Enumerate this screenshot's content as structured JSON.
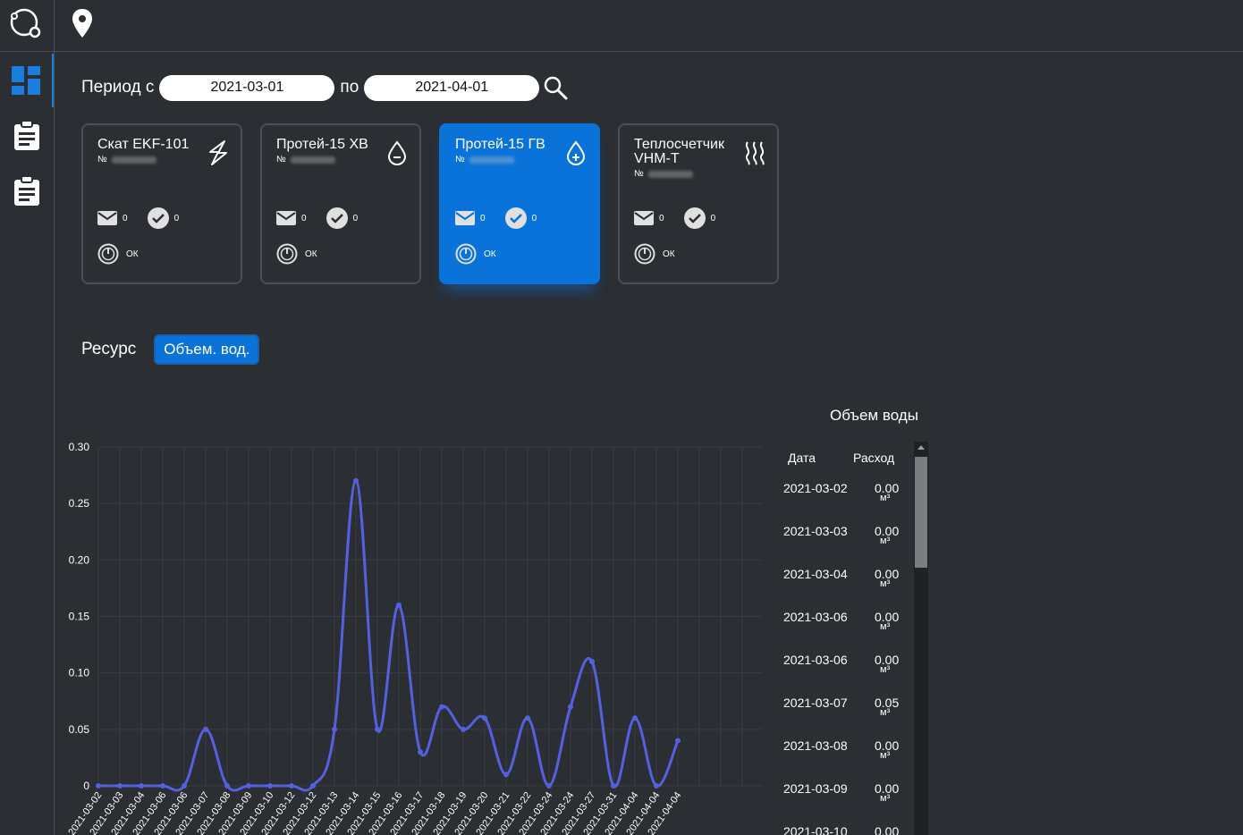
{
  "period": {
    "from_label": "Период с",
    "from_value": "2021-03-01",
    "to_label": "по",
    "to_value": "2021-04-01"
  },
  "cards": [
    {
      "title": "Скат EKF-101",
      "serial_prefix": "№",
      "messages": "0",
      "checks": "0",
      "status": "ОК",
      "icon": "lightning-icon",
      "active": false
    },
    {
      "title": "Протей-15 ХВ",
      "serial_prefix": "№",
      "messages": "0",
      "checks": "0",
      "status": "ОК",
      "icon": "water-drop-icon",
      "active": false
    },
    {
      "title": "Протей-15 ГВ",
      "serial_prefix": "№",
      "messages": "0",
      "checks": "0",
      "status": "ОК",
      "icon": "hot-water-drop-icon",
      "active": true
    },
    {
      "title": "Теплосчетчик VHM-T",
      "serial_prefix": "№",
      "messages": "0",
      "checks": "0",
      "status": "ОК",
      "icon": "heat-icon",
      "active": false
    }
  ],
  "resource": {
    "label": "Ресурс",
    "button": "Объем. вод."
  },
  "table": {
    "title": "Объем воды",
    "col_date": "Дата",
    "col_value": "Расход",
    "unit": "м³",
    "rows": [
      {
        "date": "2021-03-02",
        "value": "0.00"
      },
      {
        "date": "2021-03-03",
        "value": "0.00"
      },
      {
        "date": "2021-03-04",
        "value": "0.00"
      },
      {
        "date": "2021-03-06",
        "value": "0.00"
      },
      {
        "date": "2021-03-06",
        "value": "0.00"
      },
      {
        "date": "2021-03-07",
        "value": "0.05"
      },
      {
        "date": "2021-03-08",
        "value": "0.00"
      },
      {
        "date": "2021-03-09",
        "value": "0.00"
      },
      {
        "date": "2021-03-10",
        "value": "0.00"
      }
    ]
  },
  "colors": {
    "accent": "#0a73d9",
    "line": "#5560e0",
    "background": "#2b2e33"
  },
  "chart_data": {
    "type": "line",
    "categories": [
      "2021-03-02",
      "2021-03-03",
      "2021-03-04",
      "2021-03-06",
      "2021-03-06",
      "2021-03-07",
      "2021-03-08",
      "2021-03-09",
      "2021-03-10",
      "2021-03-12",
      "2021-03-12",
      "2021-03-13",
      "2021-03-14",
      "2021-03-15",
      "2021-03-16",
      "2021-03-17",
      "2021-03-18",
      "2021-03-19",
      "2021-03-20",
      "2021-03-21",
      "2021-03-22",
      "2021-03-24",
      "2021-03-24",
      "2021-03-27",
      "2021-03-31",
      "2021-04-04",
      "2021-04-04",
      "2021-04-04"
    ],
    "values": [
      0,
      0,
      0,
      0,
      0,
      0.05,
      0,
      0,
      0,
      0,
      0,
      0.05,
      0.27,
      0.05,
      0.16,
      0.03,
      0.07,
      0.05,
      0.06,
      0.01,
      0.06,
      0,
      0.07,
      0.11,
      0,
      0.06,
      0,
      0.04
    ],
    "ylim": [
      0,
      0.3
    ],
    "yticks": [
      "0",
      "0.05",
      "0.10",
      "0.15",
      "0.20",
      "0.25",
      "0.30"
    ],
    "grid": true
  }
}
